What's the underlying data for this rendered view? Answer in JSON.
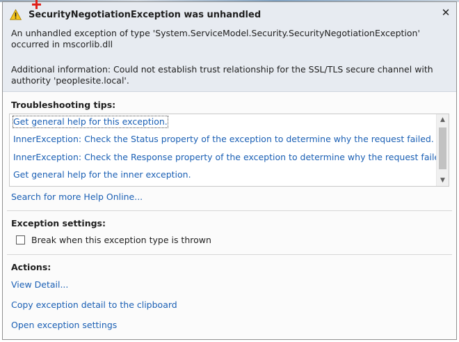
{
  "dialog": {
    "title": "SecurityNegotiationException was unhandled",
    "close_label": "✕",
    "message": "An unhandled exception of type 'System.ServiceModel.Security.SecurityNegotiationException' occurred in mscorlib.dll",
    "additional_info": "Additional information: Could not establish trust relationship for the SSL/TLS secure channel with authority 'peoplesite.local'."
  },
  "troubleshooting": {
    "heading": "Troubleshooting tips:",
    "tips": [
      "Get general help for this exception.",
      "InnerException: Check the Status property of the exception to determine why the request failed.",
      "InnerException: Check the Response property of the exception to determine why the request failed.",
      "Get general help for the inner exception."
    ],
    "search_link": "Search for more Help Online..."
  },
  "exception_settings": {
    "heading": "Exception settings:",
    "checkbox_label": "Break when this exception type is thrown",
    "checked": false
  },
  "actions": {
    "heading": "Actions:",
    "items": [
      "View Detail...",
      "Copy exception detail to the clipboard",
      "Open exception settings"
    ]
  },
  "colors": {
    "link": "#1a5fb4",
    "header_bg": "#e7ebf1",
    "warning": "#f5c518"
  },
  "icons": {
    "warning": "warning-icon",
    "close": "close-icon",
    "scroll_up": "scroll-up-icon",
    "scroll_down": "scroll-down-icon"
  }
}
